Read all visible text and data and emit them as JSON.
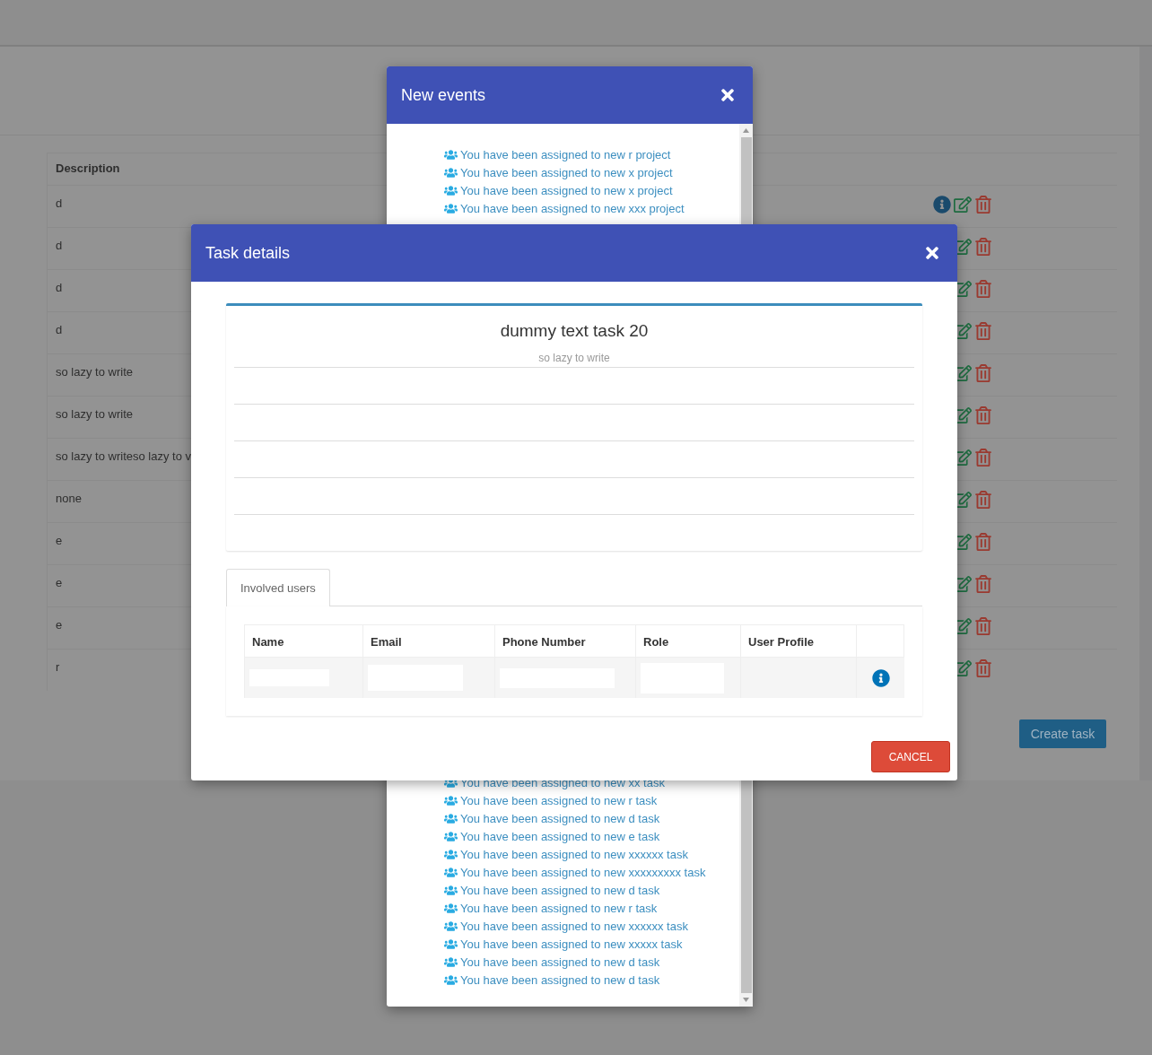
{
  "background_table": {
    "columns": [
      "Description"
    ],
    "rows": [
      {
        "description": "d",
        "actions": [
          {
            "kind": "info"
          },
          {
            "kind": "edit"
          },
          {
            "kind": "delete"
          }
        ]
      },
      {
        "description": "d",
        "actions": [
          {
            "kind": "edit"
          },
          {
            "kind": "delete"
          }
        ]
      },
      {
        "description": "d",
        "actions": [
          {
            "kind": "edit"
          },
          {
            "kind": "delete"
          }
        ]
      },
      {
        "description": "d",
        "actions": [
          {
            "kind": "edit"
          },
          {
            "kind": "delete"
          }
        ]
      },
      {
        "description": "so lazy to write",
        "actions": [
          {
            "kind": "edit"
          },
          {
            "kind": "delete"
          }
        ]
      },
      {
        "description": "so lazy to write",
        "actions": [
          {
            "kind": "edit"
          },
          {
            "kind": "delete"
          }
        ]
      },
      {
        "description": "so lazy to writeso lazy to v",
        "actions": [
          {
            "kind": "edit"
          },
          {
            "kind": "delete"
          }
        ]
      },
      {
        "description": "none",
        "actions": [
          {
            "kind": "edit"
          },
          {
            "kind": "delete"
          }
        ]
      },
      {
        "description": "e",
        "actions": [
          {
            "kind": "edit"
          },
          {
            "kind": "delete"
          }
        ]
      },
      {
        "description": "e",
        "actions": [
          {
            "kind": "edit"
          },
          {
            "kind": "delete"
          }
        ]
      },
      {
        "description": "e",
        "actions": [
          {
            "kind": "edit"
          },
          {
            "kind": "delete"
          }
        ]
      },
      {
        "description": "r",
        "actions": [
          {
            "kind": "edit"
          },
          {
            "kind": "delete"
          }
        ]
      }
    ],
    "create_button": "Create task"
  },
  "events_modal": {
    "title": "New events",
    "events_top": [
      "You have been assigned to new r project",
      "You have been assigned to new x project",
      "You have been assigned to new x project",
      "You have been assigned to new xxx project"
    ],
    "events_bottom": [
      "You have been assigned to new xx task",
      "You have been assigned to new r task",
      "You have been assigned to new d task",
      "You have been assigned to new e task",
      "You have been assigned to new xxxxxx task",
      "You have been assigned to new xxxxxxxxx task",
      "You have been assigned to new d task",
      "You have been assigned to new r task",
      "You have been assigned to new xxxxxx task",
      "You have been assigned to new xxxxx task",
      "You have been assigned to new d task",
      "You have been assigned to new d task"
    ]
  },
  "task_modal": {
    "title": "Task details",
    "task_name": "dummy text task 20",
    "task_description": "so lazy to write",
    "tabs": [
      {
        "label": "Involved users",
        "selected": true
      }
    ],
    "users_table": {
      "columns": [
        "Name",
        "Email",
        "Phone Number",
        "Role",
        "User Profile"
      ]
    },
    "cancel_button": "CANCEL"
  }
}
